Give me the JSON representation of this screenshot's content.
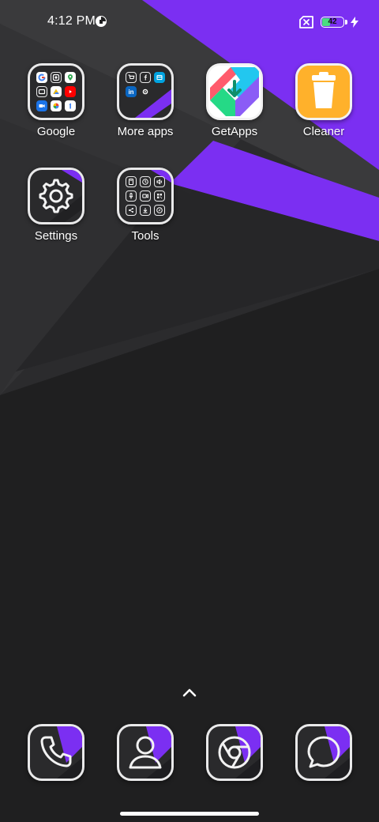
{
  "status_bar": {
    "time": "4:12 PM",
    "battery_level": "42",
    "battery_fraction": 0.42,
    "icons": [
      "data-saver-icon",
      "sim-disabled-icon",
      "battery-icon",
      "charging-bolt-icon"
    ]
  },
  "home": {
    "apps": [
      {
        "label": "Google",
        "icon": "google-folder-icon"
      },
      {
        "label": "More apps",
        "icon": "more-apps-folder-icon"
      },
      {
        "label": "GetApps",
        "icon": "getapps-icon"
      },
      {
        "label": "Cleaner",
        "icon": "cleaner-trash-icon"
      },
      {
        "label": "Settings",
        "icon": "gear-icon"
      },
      {
        "label": "Tools",
        "icon": "tools-folder-icon"
      }
    ]
  },
  "dock": {
    "apps": [
      {
        "icon": "phone-icon"
      },
      {
        "icon": "contacts-icon"
      },
      {
        "icon": "chrome-icon"
      },
      {
        "icon": "messages-icon"
      }
    ]
  },
  "theme": {
    "accent": "#7b2ff2",
    "wall_dark": "#1f1f20",
    "icon_border": "#e9e9ea",
    "battery_green": "#4ade80"
  }
}
